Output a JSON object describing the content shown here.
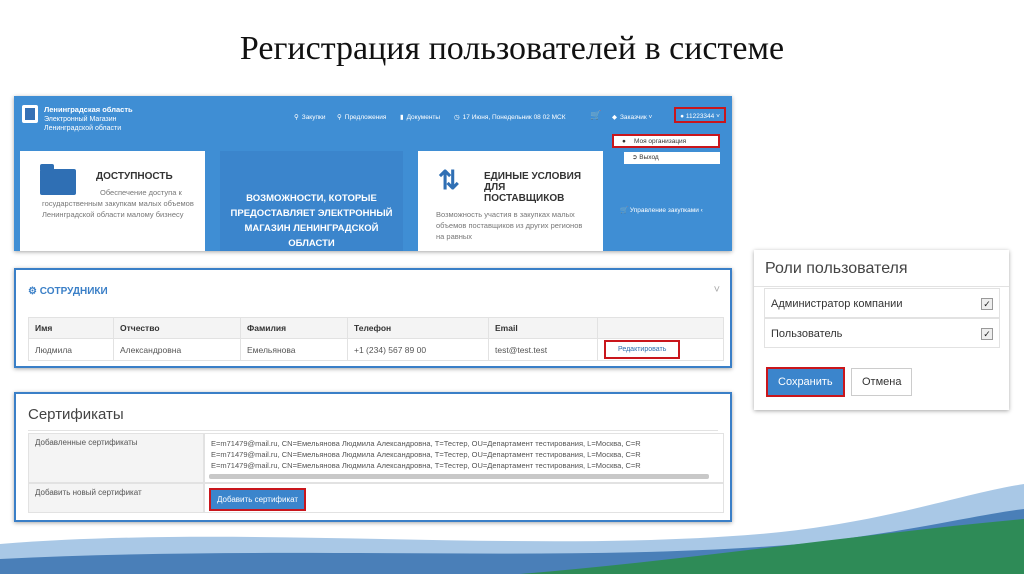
{
  "slide": {
    "title": "Регистрация пользователей в системе"
  },
  "portal": {
    "brand": {
      "line1": "Ленинградская область",
      "line2": "Электронный Магазин",
      "line3": "Ленинградской области"
    },
    "nav": [
      {
        "icon": "search-icon",
        "label": "Закупки"
      },
      {
        "icon": "search-icon",
        "label": "Предложения"
      },
      {
        "icon": "document-icon",
        "label": "Документы"
      },
      {
        "icon": "clock-icon",
        "label": "17 Июня, Понедельник 08 02 МСК"
      }
    ],
    "cart_icon": "cart-icon",
    "role_menu": "Заказчик",
    "account": "11223344",
    "dropdown": {
      "my_org": "Моя организация",
      "logout": "Выход",
      "manage": "Управление закупками"
    },
    "cards": {
      "access": {
        "title": "ДОСТУПНОСТЬ",
        "text": "Обеспечение доступа к государственным закупкам малых объемов Ленинградской области малому бизнесу"
      },
      "features": {
        "text": "ВОЗМОЖНОСТИ, КОТОРЫЕ ПРЕДОСТАВЛЯЕТ ЭЛЕКТРОННЫЙ МАГАЗИН ЛЕНИНГРАДСКОЙ ОБЛАСТИ"
      },
      "terms": {
        "title": "ЕДИНЫЕ УСЛОВИЯ ДЛЯ ПОСТАВЩИКОВ",
        "text": "Возможность участия в закупках малых объемов поставщиков из других регионов на равных"
      }
    }
  },
  "employees": {
    "title": "СОТРУДНИКИ",
    "columns": [
      "Имя",
      "Отчество",
      "Фамилия",
      "Телефон",
      "Email"
    ],
    "row": {
      "name": "Людмила",
      "patronymic": "Александровна",
      "surname": "Емельянова",
      "phone": "+1 (234) 567 89 00",
      "email": "test@test.test"
    },
    "edit_label": "Редактировать"
  },
  "certificates": {
    "title": "Сертификаты",
    "added_label": "Добавленные сертификаты",
    "lines": [
      "E=m71479@mail.ru, CN=Емельянова Людмила Александровна, T=Тестер, OU=Департамент тестирования, L=Москва, C=R",
      "E=m71479@mail.ru, CN=Емельянова Людмила Александровна, T=Тестер, OU=Департамент тестирования, L=Москва, C=R",
      "E=m71479@mail.ru, CN=Емельянова Людмила Александровна, T=Тестер, OU=Департамент тестирования, L=Москва, C=R"
    ],
    "add_label": "Добавить новый сертификат",
    "add_button": "Добавить сертификат"
  },
  "roles": {
    "title": "Роли пользователя",
    "items": [
      {
        "label": "Администратор компании",
        "checked": true
      },
      {
        "label": "Пользователь",
        "checked": true
      }
    ],
    "save": "Сохранить",
    "cancel": "Отмена"
  },
  "colors": {
    "primary": "#3f8ed4",
    "highlight": "#c9161c",
    "wave_green": "#2e8b57",
    "wave_blue": "#4a7fb8"
  }
}
